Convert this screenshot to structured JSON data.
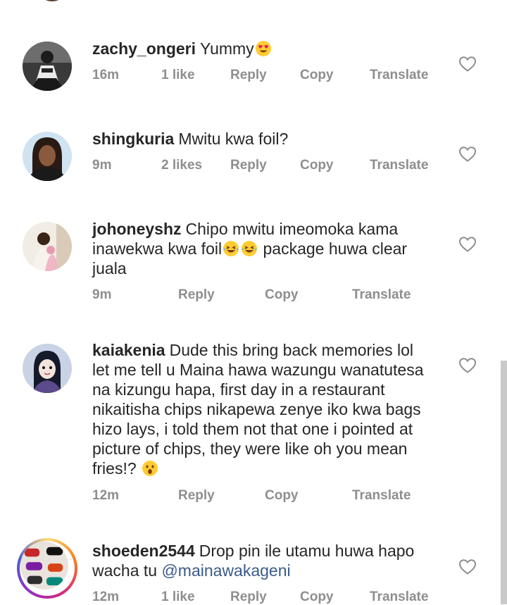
{
  "comments": [
    {
      "username": "zachy_ongeri",
      "text": "Yummy",
      "emoji_after": "heart-eyes-emoji",
      "time": "16m",
      "likes": "1 like",
      "reply": "Reply",
      "copy": "Copy",
      "translate": "Translate"
    },
    {
      "username": "shingkuria",
      "text": "Mwitu kwa foil?",
      "time": "9m",
      "likes": "2 likes",
      "reply": "Reply",
      "copy": "Copy",
      "translate": "Translate"
    },
    {
      "username": "johoneyshz",
      "line1": "Chipo mwitu imeomoka kama",
      "line2a": "inawekwa kwa foil",
      "line2b": "package huwa clear",
      "line3": "juala",
      "emoji_inline": "laughing-crying-emoji",
      "time": "9m",
      "reply": "Reply",
      "copy": "Copy",
      "translate": "Translate"
    },
    {
      "username": "kaiakenia",
      "line1": "Dude this bring back memories lol",
      "line2": "let me tell u Maina hawa wazungu wanatutesa",
      "line3": "na kizungu hapa, first day in a restaurant",
      "line4": "nikaitisha chips nikapewa zenye iko kwa bags",
      "line5": "hizo lays, i told them not that one i pointed at",
      "line6": "picture of chips, they were like oh you mean",
      "line7": "fries!?",
      "emoji_after": "astonished-emoji",
      "time": "12m",
      "reply": "Reply",
      "copy": "Copy",
      "translate": "Translate"
    },
    {
      "username": "shoeden2544",
      "line1": "Drop pin ile utamu huwa hapo",
      "line2": "wacha tu",
      "mention": "@mainawakageni",
      "time": "12m",
      "likes": "1 like",
      "reply": "Reply",
      "copy": "Copy",
      "translate": "Translate"
    }
  ],
  "colors": {
    "text": "#262626",
    "meta": "#8e8e8e",
    "mention": "#3b5a8c",
    "heart_outline": "#8e8e8e"
  }
}
